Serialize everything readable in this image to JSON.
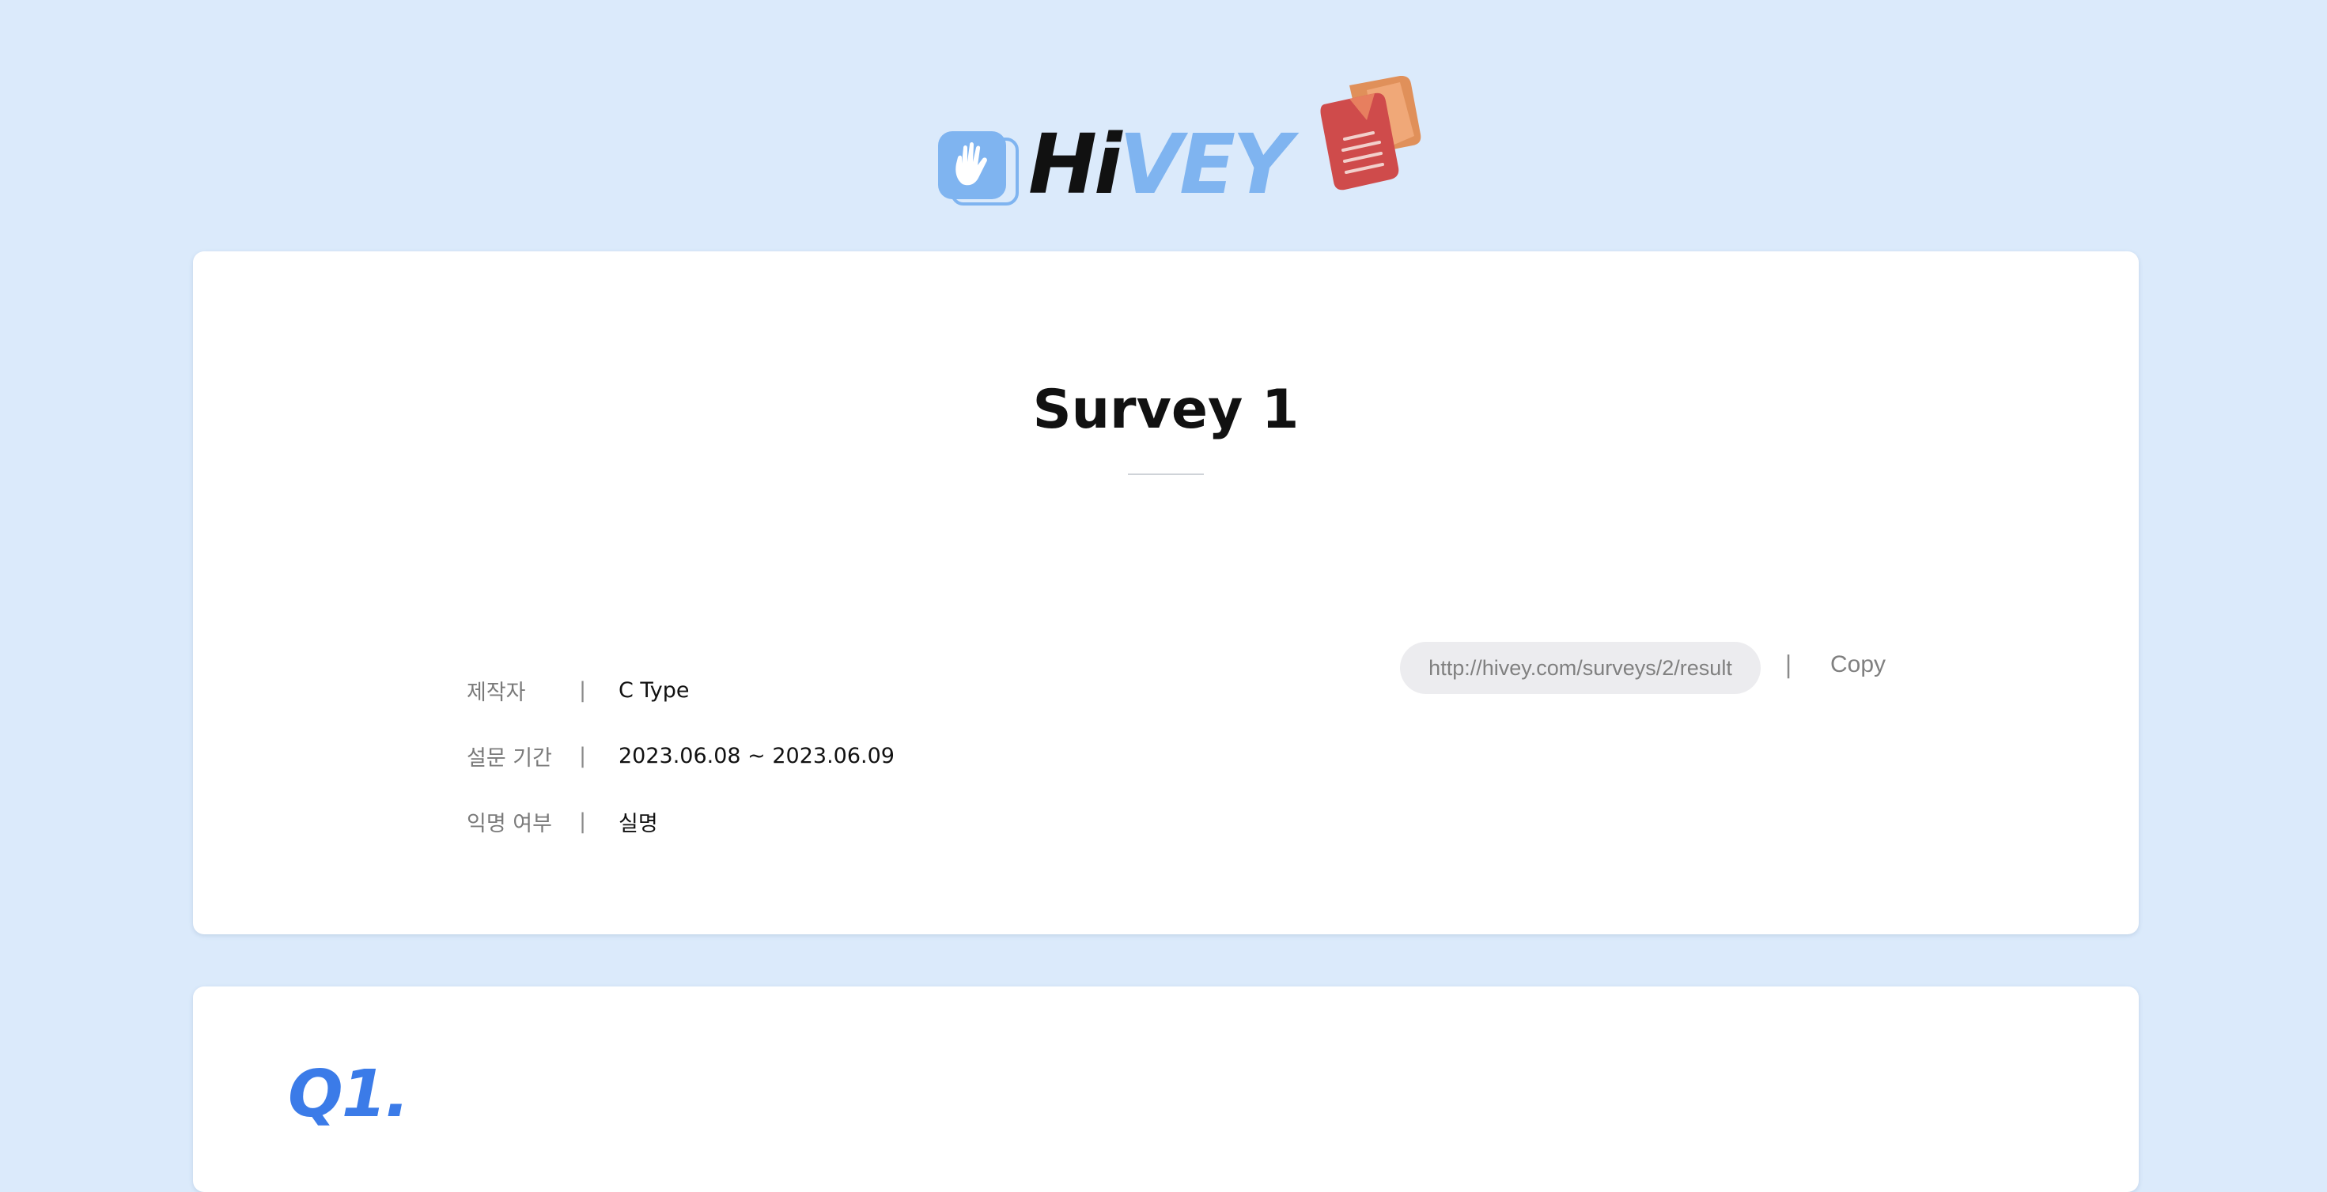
{
  "logo": {
    "text_part1": "Hi",
    "text_part2": "VEY",
    "icon_names": [
      "hand-icon",
      "documents-icon"
    ]
  },
  "survey": {
    "title": "Survey 1",
    "info": [
      {
        "label": "제작자",
        "separator": "|",
        "value": "C Type"
      },
      {
        "label": "설문 기간",
        "separator": "|",
        "value": "2023.06.08 ~ 2023.06.09"
      },
      {
        "label": "익명 여부",
        "separator": "|",
        "value": "실명"
      }
    ],
    "share": {
      "url": "http://hivey.com/surveys/2/result",
      "separator": "|",
      "copy_label": "Copy"
    }
  },
  "question": {
    "number_label": "Q1."
  },
  "colors": {
    "background": "#dbeafb",
    "brand_blue": "#7fb4f0",
    "question_blue": "#3b7be8",
    "card": "#ffffff"
  }
}
